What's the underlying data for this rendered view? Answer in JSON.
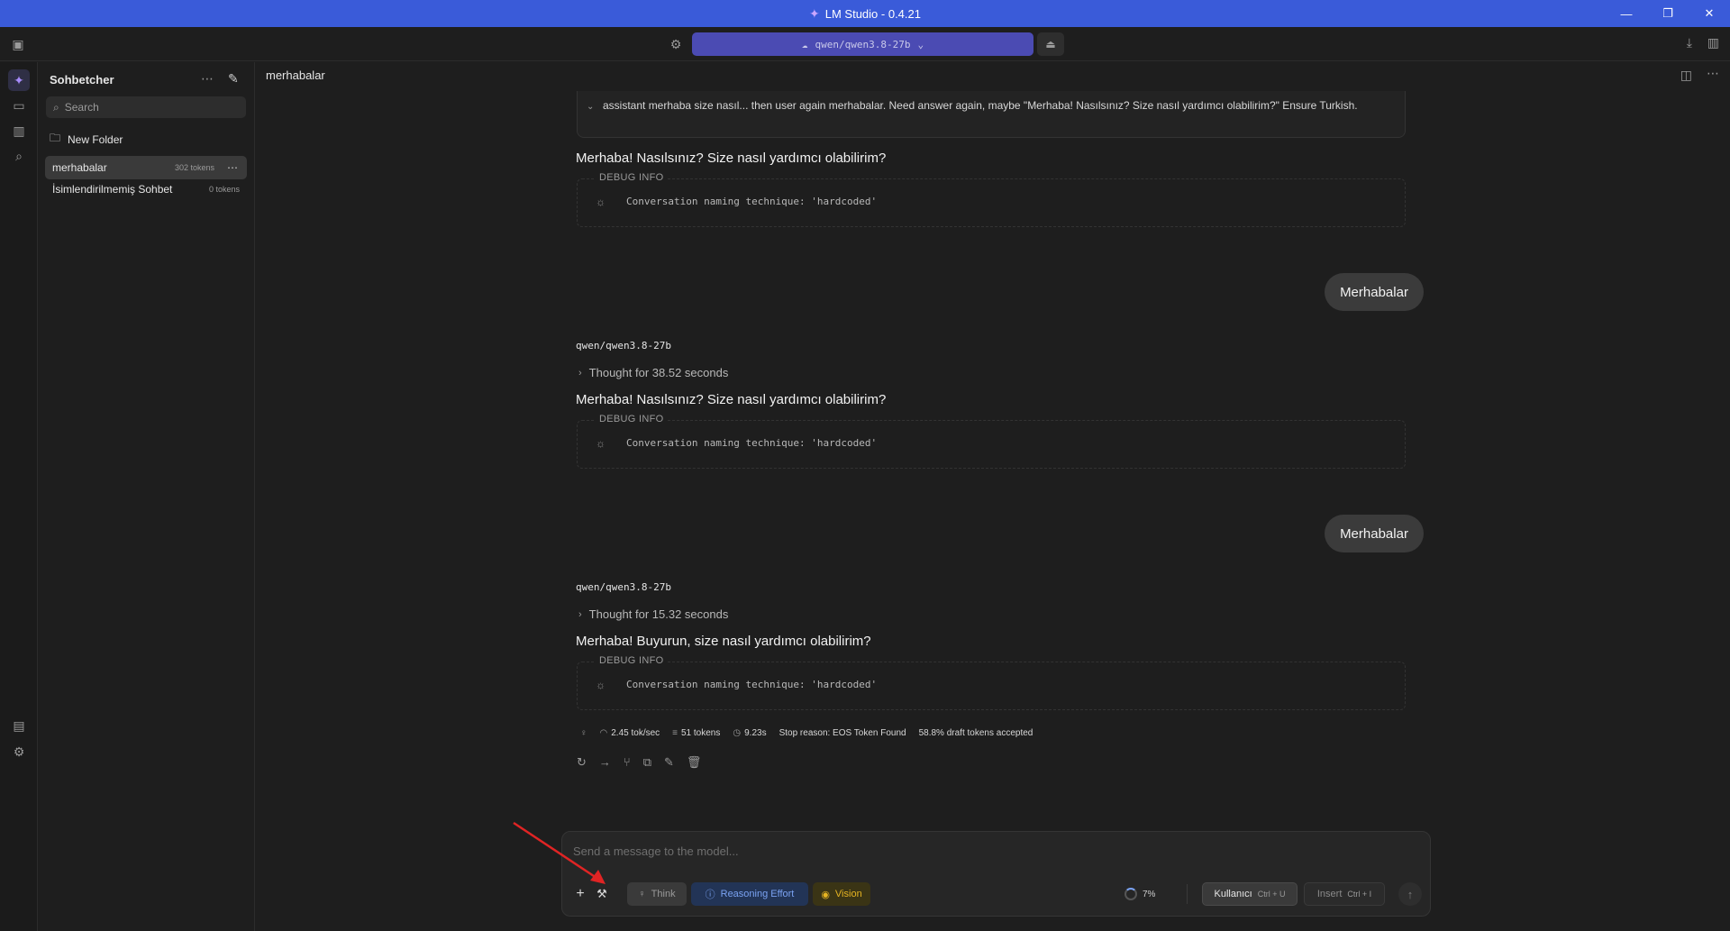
{
  "window": {
    "title": "LM Studio - 0.4.21"
  },
  "topbar": {
    "model_name": "qwen/qwen3.8-27b"
  },
  "sidebar": {
    "title": "Sohbetcher",
    "search_placeholder": "Search",
    "new_folder_label": "New Folder",
    "chats": [
      {
        "name": "merhabalar",
        "tokens": "302 tokens",
        "active": true
      },
      {
        "name": "İsimlendirilmemiş Sohbet",
        "tokens": "0 tokens",
        "active": false
      }
    ]
  },
  "chat": {
    "title": "merhabalar",
    "thought_expanded_text": "assistant merhaba size nasıl... then user again merhabalar. Need answer again, maybe \"Merhaba! Nasılsınız? Size nasıl yardımcı olabilirim?\" Ensure Turkish.",
    "messages": [
      {
        "answer": "Merhaba! Nasılsınız? Size nasıl yardımcı olabilirim?",
        "debug_label": "DEBUG INFO",
        "debug_text": "Conversation naming technique: 'hardcoded'"
      },
      {
        "user": "Merhabalar"
      },
      {
        "model": "qwen/qwen3.8-27b",
        "thought": "Thought for 38.52 seconds",
        "answer": "Merhaba! Nasılsınız? Size nasıl yardımcı olabilirim?",
        "debug_label": "DEBUG INFO",
        "debug_text": "Conversation naming technique: 'hardcoded'"
      },
      {
        "user": "Merhabalar"
      },
      {
        "model": "qwen/qwen3.8-27b",
        "thought": "Thought for 15.32 seconds",
        "answer": "Merhaba! Buyurun, size nasıl yardımcı olabilirim?",
        "debug_label": "DEBUG INFO",
        "debug_text": "Conversation naming technique: 'hardcoded'"
      }
    ],
    "stats": {
      "speed": "2.45 tok/sec",
      "tokens": "51 tokens",
      "time": "9.23s",
      "stop_reason": "Stop reason: EOS Token Found",
      "draft": "58.8% draft tokens accepted"
    }
  },
  "composer": {
    "placeholder": "Send a message to the model...",
    "think_label": "Think",
    "reasoning_label": "Reasoning Effort",
    "vision_label": "Vision",
    "context_usage": "7%",
    "user_label": "Kullanıcı",
    "user_shortcut": "Ctrl + U",
    "insert_label": "Insert",
    "insert_shortcut": "Ctrl + I"
  },
  "colors": {
    "titlebar": "#3a5bd9",
    "model_selector": "#4b4bb3",
    "reasoning": "#7aa2f2",
    "vision": "#e6b422",
    "annotation_arrow": "#e02424"
  }
}
